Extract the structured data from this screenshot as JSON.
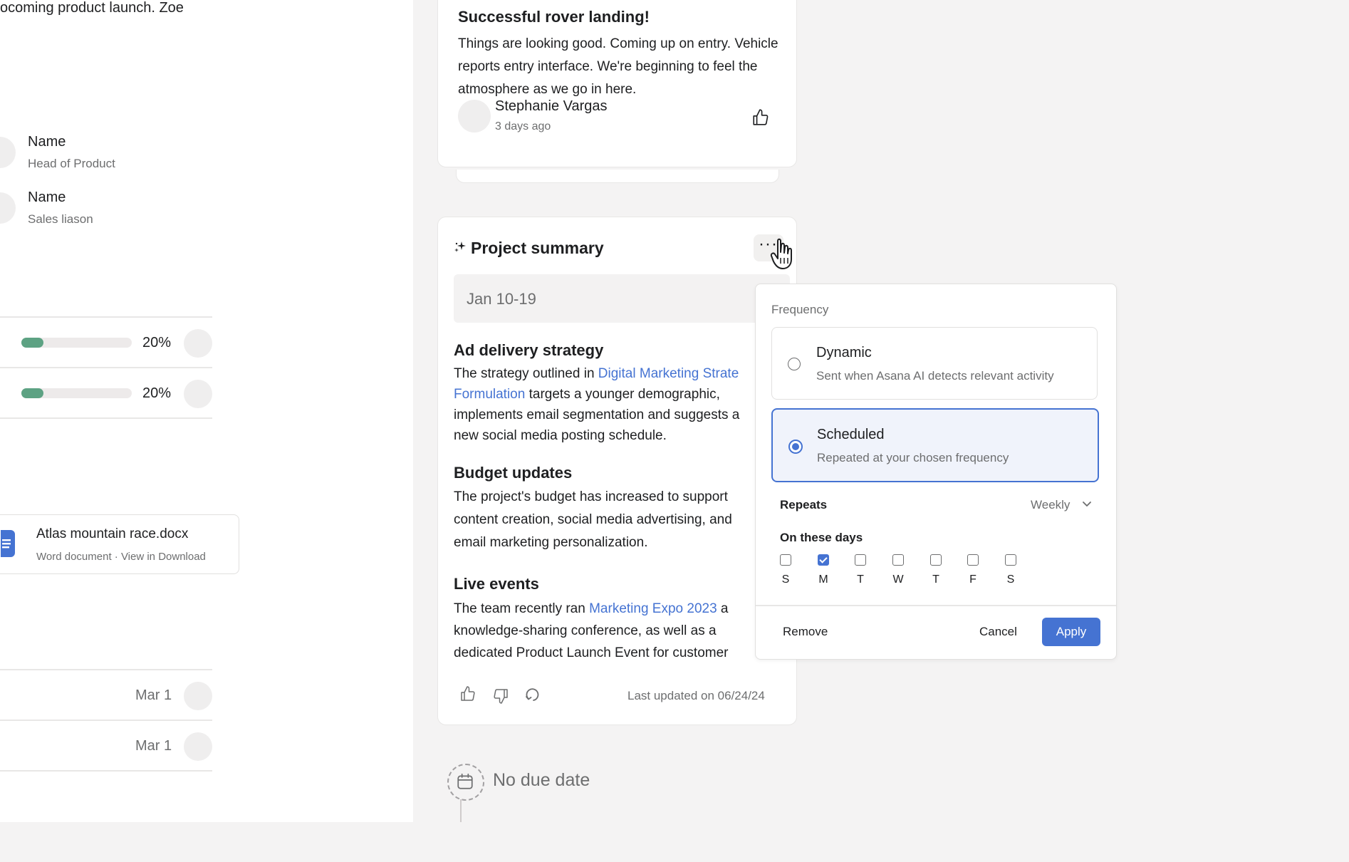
{
  "left": {
    "intro_text": "ocoming product launch. Zoe",
    "people": [
      {
        "name": "Name",
        "role": "Head of Product"
      },
      {
        "name": "Name",
        "role": "Sales liason"
      }
    ],
    "progress_rows": [
      {
        "percent_label": "20%",
        "progress": 0.2
      },
      {
        "percent_label": "20%",
        "progress": 0.2
      }
    ],
    "document": {
      "title": "Atlas mountain race.docx",
      "subtitle": "Word document · View in Download"
    },
    "date_rows": [
      {
        "date": "Mar 1"
      },
      {
        "date": "Mar 1"
      }
    ]
  },
  "update_card": {
    "title": "Successful rover landing!",
    "body": "Things are looking good. Coming up on entry. Vehicle reports entry interface. We're beginning to feel the atmosphere as we go in here.",
    "author": "Stephanie Vargas",
    "time": "3 days ago"
  },
  "summary_card": {
    "title": "Project summary",
    "more_label": "···",
    "date_range": "Jan 10-19",
    "sections": [
      {
        "heading": "Ad delivery strategy",
        "line1_pre": "The strategy outlined in ",
        "line1_link": "Digital Marketing Strate",
        "line2_link": "Formulation",
        "line2_post": " targets a younger demographic,",
        "line3": "implements email segmentation and suggests a",
        "line4": "new social media posting schedule."
      },
      {
        "heading": "Budget updates",
        "line1": "The project's budget has increased to support",
        "line2": "content creation, social media advertising, and",
        "line3": "email marketing personalization."
      },
      {
        "heading": "Live events",
        "line1_pre": "The team recently ran ",
        "line1_link": "Marketing Expo 2023",
        "line1_post": " a",
        "line2": "knowledge-sharing conference, as well as a",
        "line3": "dedicated Product Launch Event for customer"
      }
    ],
    "last_updated": "Last updated on 06/24/24"
  },
  "due_date": {
    "label": "No due date"
  },
  "frequency_popover": {
    "label": "Frequency",
    "options": [
      {
        "title": "Dynamic",
        "subtitle": "Sent when Asana AI detects relevant activity",
        "selected": false
      },
      {
        "title": "Scheduled",
        "subtitle": "Repeated at your chosen frequency",
        "selected": true
      }
    ],
    "repeats_label": "Repeats",
    "repeats_value": "Weekly",
    "days_label": "On these days",
    "days": [
      {
        "letter": "S",
        "checked": false
      },
      {
        "letter": "M",
        "checked": true
      },
      {
        "letter": "T",
        "checked": false
      },
      {
        "letter": "W",
        "checked": false
      },
      {
        "letter": "T",
        "checked": false
      },
      {
        "letter": "F",
        "checked": false
      },
      {
        "letter": "S",
        "checked": false
      }
    ],
    "remove_label": "Remove",
    "cancel_label": "Cancel",
    "apply_label": "Apply"
  },
  "colors": {
    "accent": "#4573d2",
    "progress": "#5da283",
    "muted_text": "#6d6e6f"
  },
  "icons": [
    "sparkle-icon",
    "thumbs-up-icon",
    "thumbs-down-icon",
    "regenerate-icon",
    "calendar-icon",
    "document-icon",
    "chevron-down-icon",
    "hand-cursor-icon"
  ]
}
